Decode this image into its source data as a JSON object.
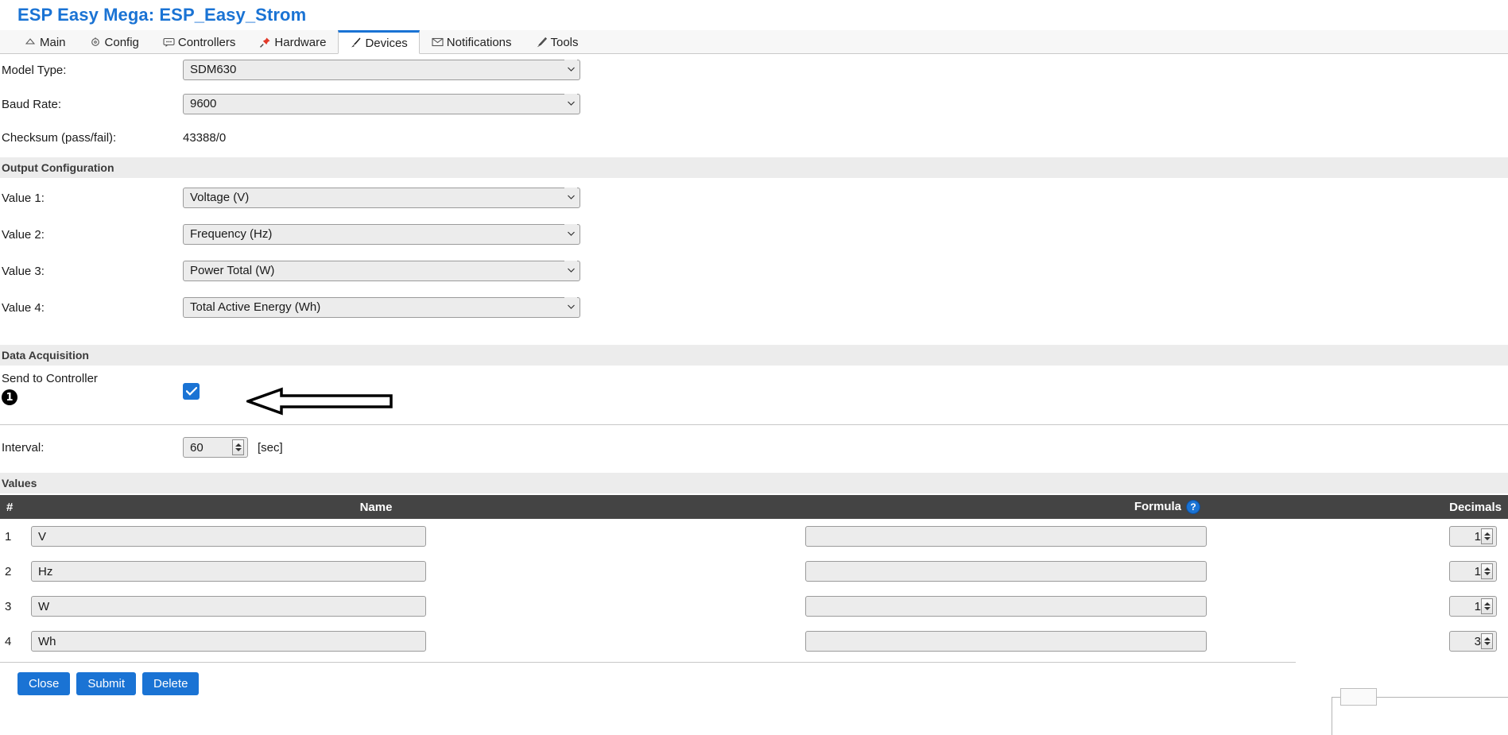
{
  "header": {
    "title": "ESP Easy Mega: ESP_Easy_Strom"
  },
  "tabs": [
    {
      "label": "Main",
      "icon": "home-icon",
      "active": false
    },
    {
      "label": "Config",
      "icon": "gear-icon",
      "active": false
    },
    {
      "label": "Controllers",
      "icon": "chat-icon",
      "active": false
    },
    {
      "label": "Hardware",
      "icon": "pin-icon",
      "active": false
    },
    {
      "label": "Devices",
      "icon": "plug-icon",
      "active": true
    },
    {
      "label": "Notifications",
      "icon": "envelope-icon",
      "active": false
    },
    {
      "label": "Tools",
      "icon": "wrench-icon",
      "active": false
    }
  ],
  "device": {
    "model_type_label": "Model Type:",
    "model_type_value": "SDM630",
    "baud_rate_label": "Baud Rate:",
    "baud_rate_value": "9600",
    "checksum_label": "Checksum (pass/fail):",
    "checksum_value": "43388/0"
  },
  "output_configuration": {
    "heading": "Output Configuration",
    "rows": [
      {
        "label": "Value 1:",
        "value": "Voltage (V)"
      },
      {
        "label": "Value 2:",
        "value": "Frequency (Hz)"
      },
      {
        "label": "Value 3:",
        "value": "Power Total (W)"
      },
      {
        "label": "Value 4:",
        "value": "Total Active Energy (Wh)"
      }
    ]
  },
  "data_acquisition": {
    "heading": "Data Acquisition",
    "send_to_controller_label": "Send to Controller",
    "send_to_controller_checked": "✓",
    "annotation_badge": "1",
    "interval_label": "Interval:",
    "interval_value": "60",
    "interval_unit": "[sec]"
  },
  "values": {
    "heading": "Values",
    "columns": {
      "num": "#",
      "name": "Name",
      "formula": "Formula",
      "formula_help": "?",
      "decimals": "Decimals"
    },
    "rows": [
      {
        "num": "1",
        "name": "V",
        "formula": "",
        "decimals": "1"
      },
      {
        "num": "2",
        "name": "Hz",
        "formula": "",
        "decimals": "1"
      },
      {
        "num": "3",
        "name": "W",
        "formula": "",
        "decimals": "1"
      },
      {
        "num": "4",
        "name": "Wh",
        "formula": "",
        "decimals": "3"
      }
    ]
  },
  "footer": {
    "close": "Close",
    "submit": "Submit",
    "delete": "Delete"
  },
  "colors": {
    "accent": "#1a73d4",
    "table_header_bg": "#444444",
    "section_bg": "#ececec",
    "annotation": "#000000"
  }
}
